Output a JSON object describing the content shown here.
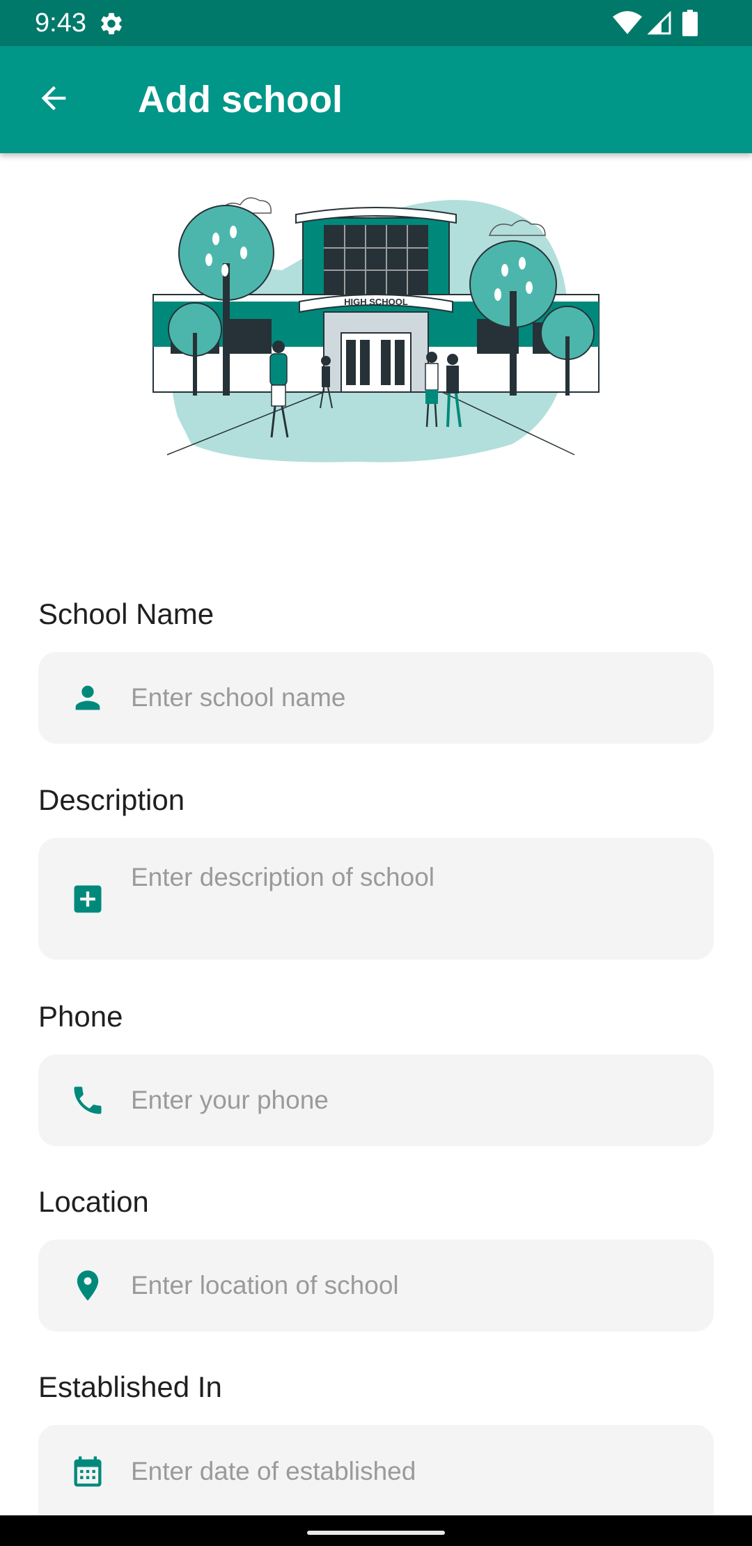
{
  "status_bar": {
    "time": "9:43",
    "icons": [
      "settings-gear-icon",
      "wifi-icon",
      "cell-signal-icon",
      "battery-icon"
    ]
  },
  "app_bar": {
    "back_icon": "arrow-back-icon",
    "title": "Add school"
  },
  "illustration": {
    "sign_text": "HIGH SCHOOL"
  },
  "form": {
    "school_name": {
      "label": "School Name",
      "placeholder": "Enter school name",
      "value": "",
      "icon": "person-icon"
    },
    "description": {
      "label": "Description",
      "placeholder": "Enter description of school",
      "value": "",
      "icon": "add-box-icon"
    },
    "phone": {
      "label": "Phone",
      "placeholder": "Enter your phone",
      "value": "",
      "icon": "phone-icon"
    },
    "location": {
      "label": "Location",
      "placeholder": "Enter location of school",
      "value": "",
      "icon": "location-pin-icon"
    },
    "established": {
      "label": "Established In",
      "placeholder": "Enter date of established",
      "value": "",
      "icon": "calendar-icon"
    }
  },
  "colors": {
    "status_bar": "#00796b",
    "app_bar": "#009688",
    "accent": "#00897b",
    "field_background": "#f4f4f4",
    "placeholder": "#9a9a9a"
  }
}
